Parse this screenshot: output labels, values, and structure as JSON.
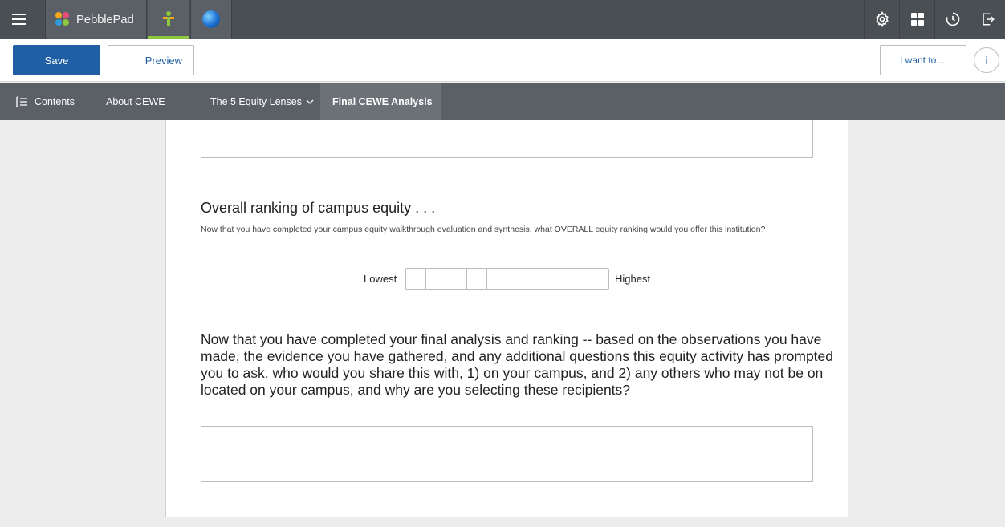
{
  "app": {
    "name": "PebblePad"
  },
  "toolbar": {
    "save_label": "Save",
    "preview_label": "Preview",
    "iwant_label": "I want to...",
    "info_label": "i"
  },
  "nav": {
    "contents_label": "Contents",
    "items": [
      {
        "label": "About CEWE"
      },
      {
        "label": "The 5 Equity Lenses"
      },
      {
        "label": "Final CEWE Analysis",
        "active": true
      }
    ]
  },
  "question1": {
    "title": "Overall ranking of campus equity . . .",
    "description": "Now that you have completed your campus equity walkthrough evaluation and synthesis, what OVERALL equity ranking would you offer this institution?",
    "scale": {
      "low_label": "Lowest",
      "high_label": "Highest",
      "steps": 10
    }
  },
  "question2": {
    "title": "Now that you have completed your final analysis and ranking -- based on the observations you have made, the evidence you have gathered, and any additional questions this equity activity has prompted you to ask, who would you share this with, 1) on your campus, and 2) any others who may not be on located on your campus, and why are you selecting these recipients?"
  },
  "colors": {
    "topbar": "#4a4f54",
    "nav": "#5b6066",
    "primary": "#1f5fa3",
    "workspace_accent": "#8dc63f"
  },
  "icons": [
    "menu-icon",
    "pebblepad-logo-icon",
    "workspace-icon",
    "globe-icon",
    "settings-icon",
    "apps-grid-icon",
    "history-icon",
    "sign-out-icon",
    "contents-list-icon",
    "chevron-down-icon"
  ]
}
